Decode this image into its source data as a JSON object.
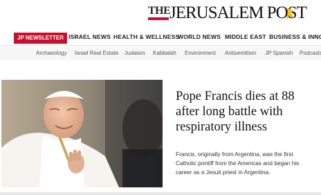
{
  "logo": {
    "prefix": "THE",
    "name": "JERUSALEM POST"
  },
  "nav": {
    "newsletter": "JP NEWSLETTER",
    "items": [
      "ISRAEL NEWS",
      "HEALTH & WELLNESS",
      "WORLD NEWS",
      "MIDDLE EAST",
      "BUSINESS & INNOVA"
    ]
  },
  "subnav": {
    "items": [
      "Archaeology",
      "Israel Real Estate",
      "Judaism",
      "Kabbalah",
      "Environment",
      "Antisemitism",
      "JP Spanish",
      "Podcasts"
    ]
  },
  "article": {
    "headline": "Pope Francis dies at 88 after long battle with respiratory illness",
    "summary": "Francis, originally from Argentina, was the first Catholic pontiff from the Americas and began his career as a Jesuit priest in Argentina."
  },
  "colors": {
    "brand_red": "#c8102e",
    "flag_yellow": "#f5c518"
  },
  "icons": {
    "logo_flag": "yellow-flag-icon"
  }
}
